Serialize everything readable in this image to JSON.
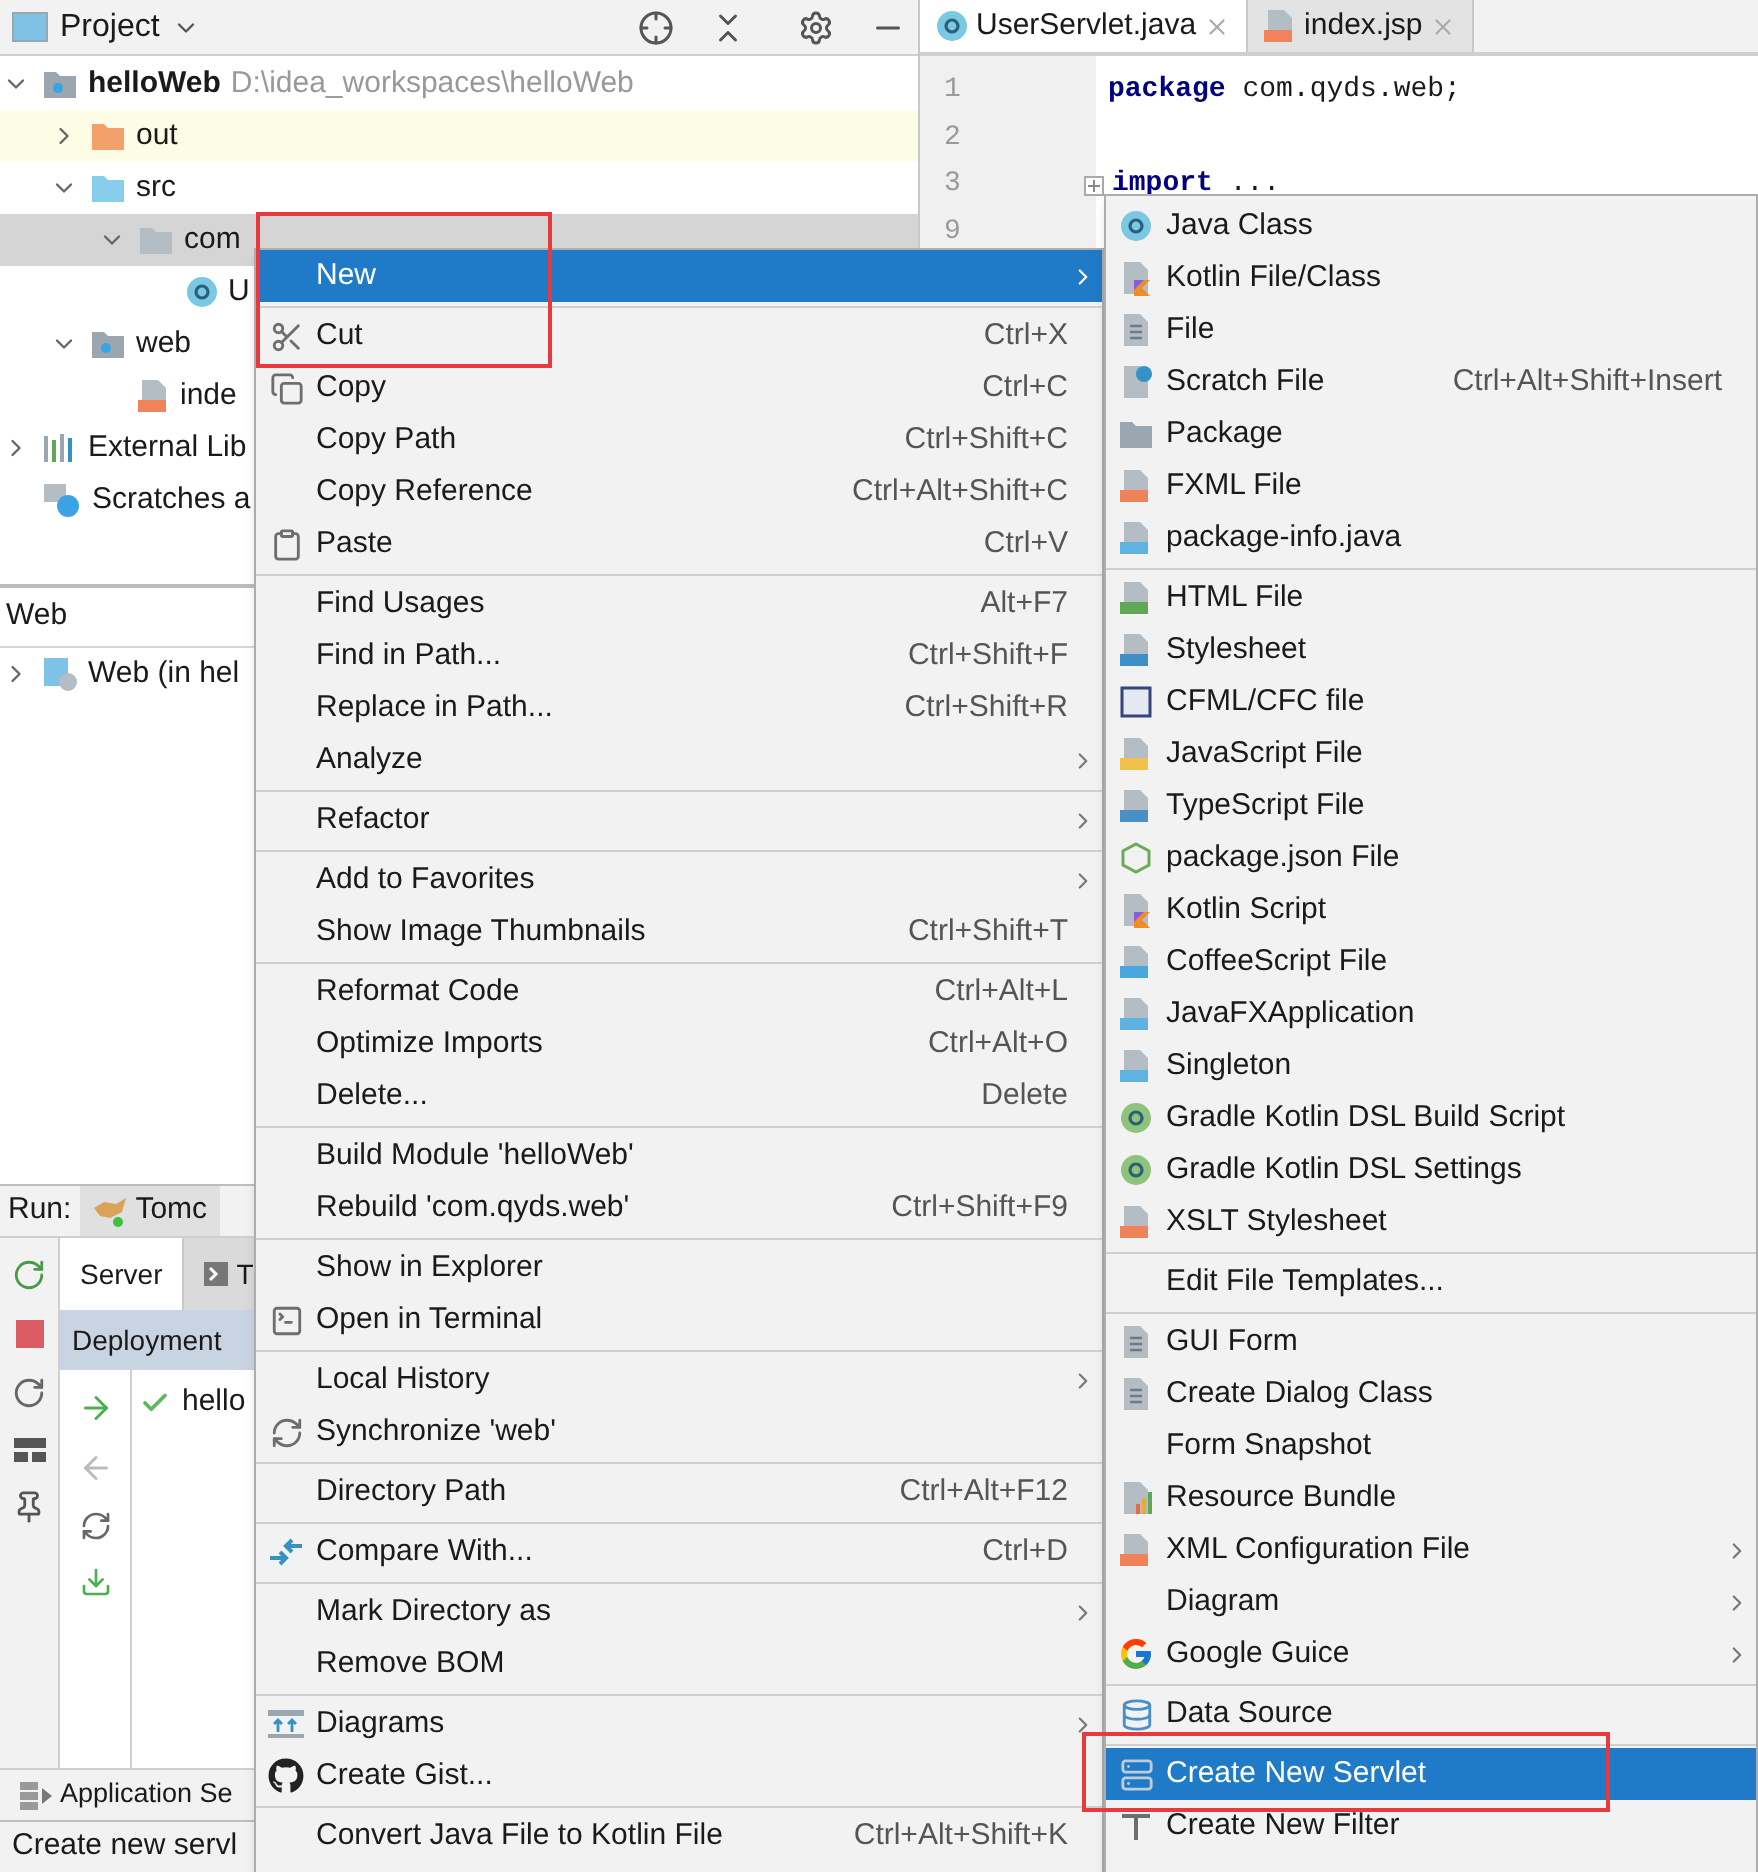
{
  "project_panel": {
    "title": "Project",
    "tree": [
      {
        "label": "helloWeb",
        "detail": "D:\\idea_workspaces\\helloWeb",
        "kind": "module",
        "expanded": true,
        "selected": false,
        "children": [
          {
            "label": "out",
            "kind": "excluded-folder",
            "expanded": false,
            "selected": false
          },
          {
            "label": "src",
            "kind": "source-folder",
            "expanded": true,
            "selected": false,
            "children": [
              {
                "label": "com",
                "kind": "package",
                "expanded": true,
                "selected": true,
                "children": [
                  {
                    "label": "U",
                    "kind": "class",
                    "selected": false
                  }
                ]
              }
            ]
          },
          {
            "label": "web",
            "kind": "web-folder",
            "expanded": true,
            "selected": false,
            "children": [
              {
                "label": "inde",
                "kind": "jsp",
                "selected": false
              }
            ]
          }
        ]
      },
      {
        "label": "External Lib",
        "kind": "library",
        "expanded": false,
        "selected": false
      },
      {
        "label": "Scratches a",
        "kind": "scratches",
        "selected": false
      }
    ]
  },
  "web_panel": {
    "title": "Web",
    "tree": [
      {
        "label": "Web (in hel",
        "kind": "web",
        "expanded": false,
        "selected": false
      }
    ]
  },
  "run_panel": {
    "label": "Run:",
    "tabs": [
      {
        "label": "Tomc",
        "selected": true
      }
    ],
    "inner_tabs": [
      {
        "label": "Server",
        "selected": true
      },
      {
        "label": "T",
        "selected": false
      }
    ],
    "deployment_header": "Deployment",
    "deployments": [
      {
        "label": "hello",
        "deployed": true
      }
    ],
    "services_bar": "Application Se"
  },
  "status_bar": "Create new servl",
  "editor": {
    "tabs": [
      {
        "label": "UserServlet.java",
        "kind": "class",
        "selected": true
      },
      {
        "label": "index.jsp",
        "kind": "jsp",
        "selected": false
      }
    ],
    "lines": [
      {
        "number": "1",
        "code": "**package** com.qyds.web;"
      },
      {
        "number": "2"
      },
      {
        "number": "3",
        "code": "**import** ...",
        "folded": true
      },
      {
        "number": "9"
      }
    ]
  },
  "context_menu": {
    "groups": [
      [
        {
          "label": "New",
          "submenu": true,
          "selected": true
        }
      ],
      [
        {
          "label": "Cut",
          "shortcut": "Ctrl+X",
          "kind": "scissors",
          "selected": false
        },
        {
          "label": "Copy",
          "shortcut": "Ctrl+C",
          "kind": "copy",
          "selected": false
        },
        {
          "label": "Copy Path",
          "shortcut": "Ctrl+Shift+C",
          "selected": false
        },
        {
          "label": "Copy Reference",
          "shortcut": "Ctrl+Alt+Shift+C",
          "selected": false
        },
        {
          "label": "Paste",
          "shortcut": "Ctrl+V",
          "kind": "paste",
          "selected": false
        }
      ],
      [
        {
          "label": "Find Usages",
          "shortcut": "Alt+F7",
          "selected": false
        },
        {
          "label": "Find in Path...",
          "shortcut": "Ctrl+Shift+F",
          "selected": false
        },
        {
          "label": "Replace in Path...",
          "shortcut": "Ctrl+Shift+R",
          "selected": false
        },
        {
          "label": "Analyze",
          "submenu": true,
          "selected": false
        }
      ],
      [
        {
          "label": "Refactor",
          "submenu": true,
          "selected": false
        }
      ],
      [
        {
          "label": "Add to Favorites",
          "submenu": true,
          "selected": false
        },
        {
          "label": "Show Image Thumbnails",
          "shortcut": "Ctrl+Shift+T",
          "selected": false
        }
      ],
      [
        {
          "label": "Reformat Code",
          "shortcut": "Ctrl+Alt+L",
          "selected": false
        },
        {
          "label": "Optimize Imports",
          "shortcut": "Ctrl+Alt+O",
          "selected": false
        },
        {
          "label": "Delete...",
          "shortcut": "Delete",
          "selected": false
        }
      ],
      [
        {
          "label": "Build Module 'helloWeb'",
          "selected": false
        },
        {
          "label": "Rebuild 'com.qyds.web'",
          "shortcut": "Ctrl+Shift+F9",
          "selected": false
        }
      ],
      [
        {
          "label": "Show in Explorer",
          "selected": false
        },
        {
          "label": "Open in Terminal",
          "kind": "terminal",
          "selected": false
        }
      ],
      [
        {
          "label": "Local History",
          "submenu": true,
          "selected": false
        },
        {
          "label": "Synchronize 'web'",
          "kind": "sync",
          "selected": false
        }
      ],
      [
        {
          "label": "Directory Path",
          "shortcut": "Ctrl+Alt+F12",
          "selected": false
        }
      ],
      [
        {
          "label": "Compare With...",
          "shortcut": "Ctrl+D",
          "kind": "compare",
          "selected": false
        }
      ],
      [
        {
          "label": "Mark Directory as",
          "submenu": true,
          "selected": false
        },
        {
          "label": "Remove BOM",
          "selected": false
        }
      ],
      [
        {
          "label": "Diagrams",
          "submenu": true,
          "kind": "diagrams",
          "selected": false
        },
        {
          "label": "Create Gist...",
          "kind": "github",
          "selected": false
        }
      ],
      [
        {
          "label": "Convert Java File to Kotlin File",
          "shortcut": "Ctrl+Alt+Shift+K",
          "selected": false
        }
      ]
    ]
  },
  "new_submenu": {
    "groups": [
      [
        {
          "label": "Java Class",
          "kind": "java-class",
          "selected": false
        },
        {
          "label": "Kotlin File/Class",
          "kind": "kotlin-file",
          "selected": false
        },
        {
          "label": "File",
          "kind": "file",
          "selected": false
        },
        {
          "label": "Scratch File",
          "shortcut": "Ctrl+Alt+Shift+Insert",
          "kind": "scratch-file",
          "selected": false
        },
        {
          "label": "Package",
          "kind": "package",
          "selected": false
        },
        {
          "label": "FXML File",
          "kind": "fxml",
          "selected": false
        },
        {
          "label": "package-info.java",
          "kind": "java-file",
          "selected": false
        }
      ],
      [
        {
          "label": "HTML File",
          "kind": "html",
          "selected": false
        },
        {
          "label": "Stylesheet",
          "kind": "css",
          "selected": false
        },
        {
          "label": "CFML/CFC file",
          "kind": "cfml",
          "selected": false
        },
        {
          "label": "JavaScript File",
          "kind": "javascript",
          "selected": false
        },
        {
          "label": "TypeScript File",
          "kind": "typescript",
          "selected": false
        },
        {
          "label": "package.json File",
          "kind": "nodejs",
          "selected": false
        },
        {
          "label": "Kotlin Script",
          "kind": "kotlin-script",
          "selected": false
        },
        {
          "label": "CoffeeScript File",
          "kind": "coffeescript",
          "selected": false
        },
        {
          "label": "JavaFXApplication",
          "kind": "java-file",
          "selected": false
        },
        {
          "label": "Singleton",
          "kind": "java-file",
          "selected": false
        },
        {
          "label": "Gradle Kotlin DSL Build Script",
          "kind": "gradle",
          "selected": false
        },
        {
          "label": "Gradle Kotlin DSL Settings",
          "kind": "gradle",
          "selected": false
        },
        {
          "label": "XSLT Stylesheet",
          "kind": "xml",
          "selected": false
        }
      ],
      [
        {
          "label": "Edit File Templates...",
          "selected": false
        }
      ],
      [
        {
          "label": "GUI Form",
          "kind": "gui-form",
          "selected": false
        },
        {
          "label": "Create Dialog Class",
          "kind": "gui-form",
          "selected": false
        },
        {
          "label": "Form Snapshot",
          "selected": false
        },
        {
          "label": "Resource Bundle",
          "kind": "resource-bundle",
          "selected": false
        },
        {
          "label": "XML Configuration File",
          "kind": "xml",
          "submenu": true,
          "selected": false
        },
        {
          "label": "Diagram",
          "submenu": true,
          "selected": false
        },
        {
          "label": "Google Guice",
          "kind": "google",
          "submenu": true,
          "selected": false
        }
      ],
      [
        {
          "label": "Data Source",
          "kind": "database",
          "selected": false
        }
      ],
      [
        {
          "label": "Create New Servlet",
          "kind": "servlet",
          "selected": true
        },
        {
          "label": "Create New Filter",
          "kind": "filter",
          "selected": false
        }
      ]
    ]
  }
}
